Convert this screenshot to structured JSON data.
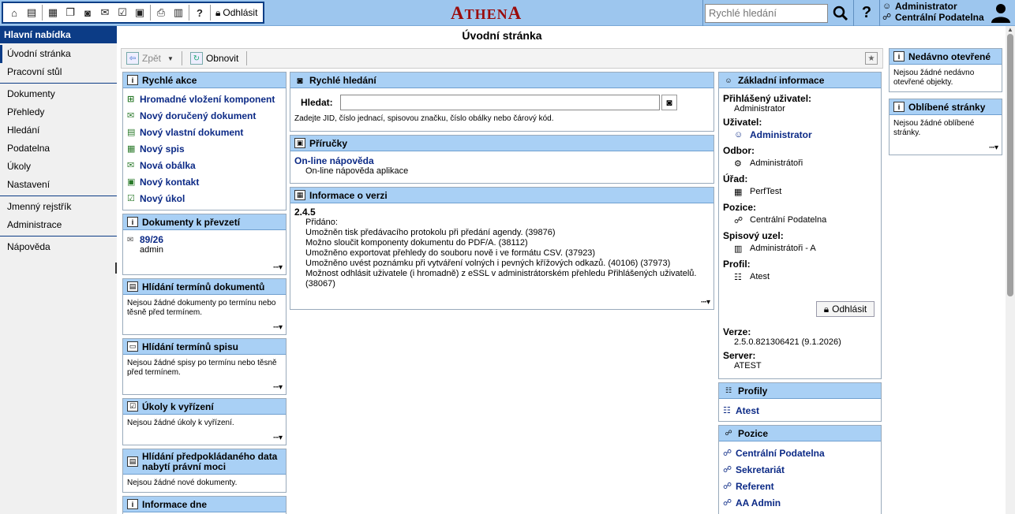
{
  "toolbar": {
    "logout_label": "Odhlásit"
  },
  "logo": {
    "first": "A",
    "middle": "THEN",
    "last": "A"
  },
  "top_search": {
    "placeholder": "Rychlé hledání"
  },
  "user": {
    "name": "Administrator",
    "position": "Centrální Podatelna"
  },
  "sidebar": {
    "title": "Hlavní nabídka",
    "groups": [
      [
        "Úvodní stránka",
        "Pracovní stůl"
      ],
      [
        "Dokumenty",
        "Přehledy",
        "Hledání",
        "Podatelna",
        "Úkoly",
        "Nastavení"
      ],
      [
        "Jmenný rejstřík",
        "Administrace"
      ],
      [
        "Nápověda"
      ]
    ]
  },
  "page_title": "Úvodní stránka",
  "actionbar": {
    "back": "Zpět",
    "refresh": "Obnovit"
  },
  "quick_actions": {
    "title": "Rychlé akce",
    "items": [
      "Hromadné vložení komponent",
      "Nový doručený dokument",
      "Nový vlastní dokument",
      "Nový spis",
      "Nová obálka",
      "Nový kontakt",
      "Nový úkol"
    ]
  },
  "docs_to_take": {
    "title": "Dokumenty k převzetí",
    "item_id": "89/26",
    "item_user": "admin"
  },
  "doc_deadlines": {
    "title": "Hlídání termínů dokumentů",
    "text": "Nejsou žádné dokumenty po termínu nebo těsně před termínem."
  },
  "file_deadlines": {
    "title": "Hlídání termínů spisu",
    "text": "Nejsou žádné spisy po termínu nebo těsně před termínem."
  },
  "tasks": {
    "title": "Úkoly k vyřízení",
    "text": "Nejsou žádné úkoly k vyřízení."
  },
  "legal_force": {
    "title": "Hlídání předpokládaného data nabytí právní moci",
    "text": "Nejsou žádné nové dokumenty."
  },
  "day_info": {
    "title": "Informace dne"
  },
  "quick_search": {
    "title": "Rychlé hledání",
    "label": "Hledat:",
    "hint": "Zadejte JID, číslo jednací, spisovou značku, číslo obálky nebo čárový kód."
  },
  "manuals": {
    "title": "Příručky",
    "link": "On-line nápověda",
    "desc": "On-line nápověda aplikace"
  },
  "version_info": {
    "title": "Informace o verzi",
    "version": "2.4.5",
    "added_label": "Přidáno:",
    "items": [
      "Umožněn tisk předávacího protokolu při předání agendy. (39876)",
      "Možno sloučit komponenty dokumentu do PDF/A. (38112)",
      "Umožněno exportovat přehledy do souboru nově i ve formátu CSV. (37923)",
      "Umožněno uvést poznámku při vytváření volných i pevných křížových odkazů. (40106) (37973)",
      "Možnost odhlásit uživatele (i hromadně) z eSSL v administrátorském přehledu Přihlášených uživatelů. (38067)"
    ]
  },
  "basic_info": {
    "title": "Základní informace",
    "logged_user_label": "Přihlášený uživatel:",
    "logged_user": "Administrator",
    "user_label": "Uživatel:",
    "user": "Administrator",
    "dept_label": "Odbor:",
    "dept": "Administrátoři",
    "office_label": "Úřad:",
    "office": "PerfTest",
    "position_label": "Pozice:",
    "position": "Centrální Podatelna",
    "registry_label": "Spisový uzel:",
    "registry": "Administrátoři - A",
    "profile_label": "Profil:",
    "profile": "Atest",
    "logout_label": "Odhlásit",
    "version_label": "Verze:",
    "version": "2.5.0.821306421 (9.1.2026)",
    "server_label": "Server:",
    "server": "ATEST"
  },
  "profiles": {
    "title": "Profily",
    "items": [
      "Atest"
    ]
  },
  "positions": {
    "title": "Pozice",
    "items": [
      "Centrální Podatelna",
      "Sekretariát",
      "Referent",
      "AA Admin"
    ]
  },
  "recent": {
    "title": "Nedávno otevřené",
    "text": "Nejsou žádné nedávno otevřené objekty."
  },
  "favorites": {
    "title": "Oblíbené stránky",
    "text": "Nejsou žádné oblíbené stránky."
  },
  "more_label": "···▾"
}
